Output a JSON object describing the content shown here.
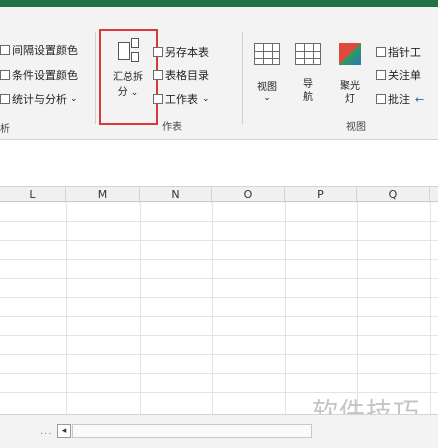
{
  "ribbon": {
    "left_items": [
      "间隔设置颜色",
      "条件设置颜色",
      "统计与分析"
    ],
    "left_caption": "析",
    "split_button": {
      "label_line1": "汇总拆",
      "label_line2": "分"
    },
    "sheet_items": [
      "另存本表",
      "表格目录",
      "工作表"
    ],
    "sheet_caption": "作表",
    "view_buttons": [
      {
        "label": "视图"
      },
      {
        "label": "导航"
      },
      {
        "label": "聚光灯"
      }
    ],
    "view_items": [
      "指针工",
      "关注单",
      "批注"
    ],
    "view_caption": "视图"
  },
  "columns": [
    "L",
    "M",
    "N",
    "O",
    "P",
    "Q"
  ],
  "watermark": "软件技巧",
  "status": {
    "dots": "..."
  }
}
